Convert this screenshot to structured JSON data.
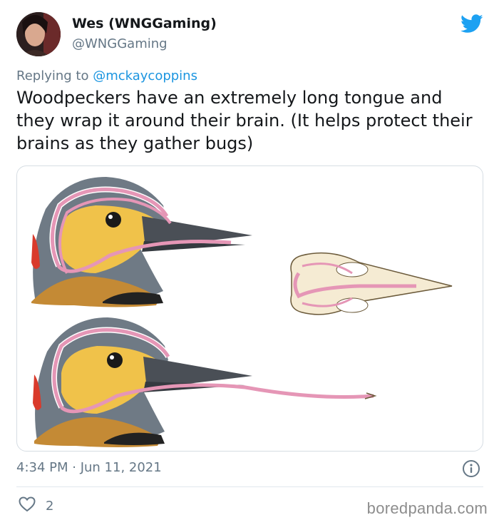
{
  "tweet": {
    "author_name": "Wes (WNGGaming)",
    "author_handle": "@WNGGaming",
    "reply_prefix": "Replying to ",
    "reply_to": "@mckaycoppins",
    "text": "Woodpeckers have an extremely long tongue and they wrap it around their brain. (It helps protect their brains as they gather bugs)",
    "timestamp": "4:34 PM · Jun 11, 2021",
    "like_count": "2"
  },
  "icons": {
    "brand": "twitter-bird-icon",
    "info": "info-icon",
    "like": "heart-icon"
  },
  "watermark": "boredpanda.com",
  "colors": {
    "brand_blue": "#1da1f2",
    "secondary_text": "#657786",
    "link": "#1b95e0",
    "tongue_pink": "#e596b6"
  }
}
